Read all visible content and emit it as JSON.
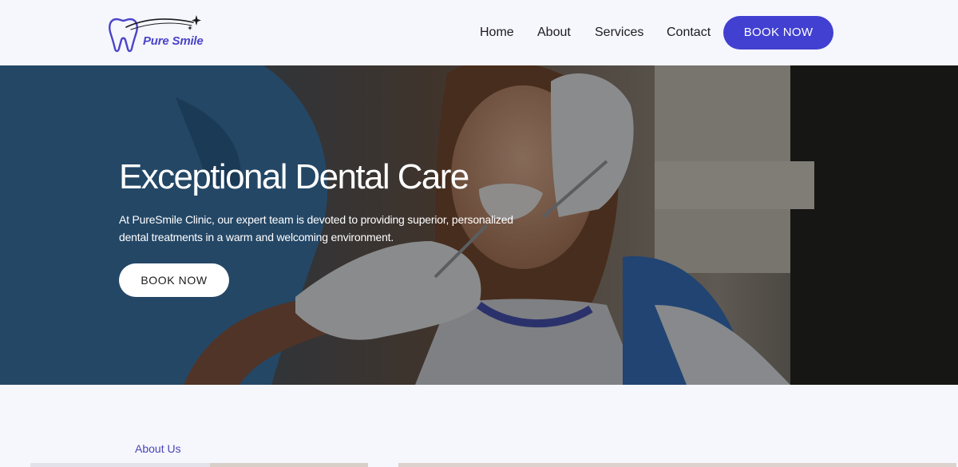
{
  "brand": {
    "name": "Pure Smile",
    "accent": "#4140d1"
  },
  "nav": {
    "items": [
      "Home",
      "About",
      "Services",
      "Contact"
    ],
    "cta_label": "BOOK NOW"
  },
  "hero": {
    "title": "Exceptional Dental Care",
    "text": "At PureSmile Clinic, our expert team is devoted to providing superior, personalized dental treatments in a warm and welcoming environment.",
    "cta_label": "BOOK NOW",
    "image": "dentist-treating-patient-photo"
  },
  "about": {
    "label": "About Us"
  }
}
